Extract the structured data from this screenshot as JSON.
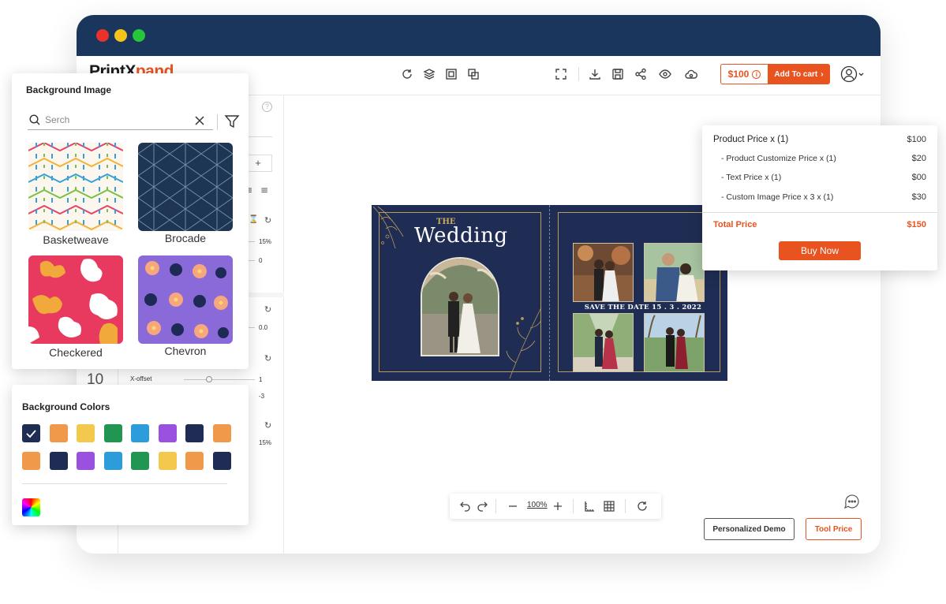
{
  "brand": {
    "logo_part1": "PrintX",
    "logo_part2": "pand",
    "accent": "#e8531f",
    "navy": "#1b365d"
  },
  "window": {
    "traffic_lights": [
      "#e8322b",
      "#f3c31b",
      "#26c53c"
    ]
  },
  "toolbar": {
    "price": "$100",
    "add_to_cart": "Add To cart",
    "icons": [
      "refresh-icon",
      "layers-icon",
      "frame-icon",
      "duplicate-icon",
      "fullscreen-icon",
      "download-icon",
      "save-icon",
      "share-icon",
      "preview-icon",
      "cloud-icon",
      "user-icon"
    ]
  },
  "side_panel": {
    "opacity_value": "15%",
    "rotation_value": "0",
    "blur_value": "0.0",
    "font_size": "10",
    "x_offset_label": "X-offset",
    "x_offset_value": "1",
    "y_offset_value": "-3",
    "shadow_value": "15%"
  },
  "design": {
    "the": "THE",
    "title": "Wedding",
    "save_the_date": "SAVE THE DATE 15 . 3 . 2022",
    "bg_color": "#1f2d54"
  },
  "zoom_bar": {
    "zoom": "100%"
  },
  "footer": {
    "demo_button": "Personalized Demo",
    "tool_price_button": "Tool Price"
  },
  "background_image_panel": {
    "title": "Background Image",
    "search_placeholder": "Serch",
    "patterns": [
      {
        "label": "Basketweave"
      },
      {
        "label": "Brocade"
      },
      {
        "label": "Checkered"
      },
      {
        "label": "Chevron"
      }
    ]
  },
  "background_colors_panel": {
    "title": "Background Colors",
    "row1": [
      "#1f2d54",
      "#f1994a",
      "#f2c94c",
      "#219653",
      "#2d9cdb",
      "#9b51e0",
      "#1f2d54",
      "#f1994a"
    ],
    "row2": [
      "#f1994a",
      "#1f2d54",
      "#9b51e0",
      "#2d9cdb",
      "#219653",
      "#f2c94c",
      "#f1994a",
      "#1f2d54"
    ],
    "selected_index": 0
  },
  "price_panel": {
    "product_price_label": "Product Price  x  (1)",
    "product_price": "$100",
    "items": [
      {
        "label": "- Product Customize Price  x  (1)",
        "value": "$20"
      },
      {
        "label": "- Text Price x (1)",
        "value": "$00"
      },
      {
        "label": "- Custom Image Price x 3 x  (1)",
        "value": "$30"
      }
    ],
    "total_label": "Total Price",
    "total_value": "$150",
    "buy_now": "Buy Now"
  }
}
